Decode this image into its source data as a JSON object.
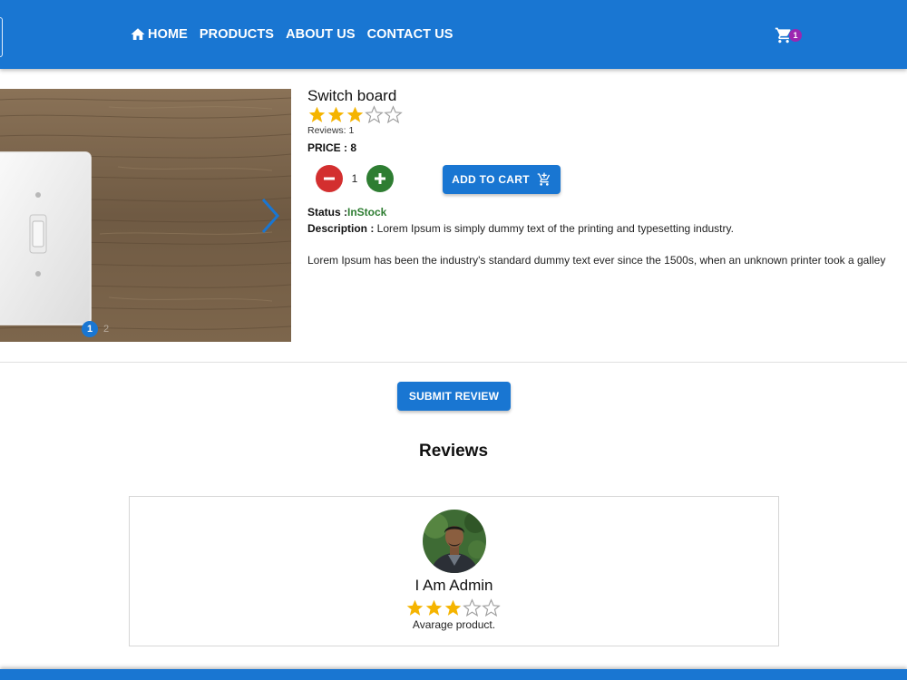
{
  "nav": {
    "items": [
      {
        "label": "HOME",
        "icon": "home-icon"
      },
      {
        "label": "PRODUCTS"
      },
      {
        "label": "ABOUT US"
      },
      {
        "label": "CONTACT US"
      }
    ],
    "cart_count": "1"
  },
  "gallery": {
    "active_dot": "1",
    "dot2": "2"
  },
  "product": {
    "title": "Switch board",
    "rating": 3,
    "rating_max": 5,
    "reviews_label": "Reviews: 1",
    "price_label": "PRICE : 8",
    "quantity": "1",
    "add_to_cart_label": "ADD TO CART",
    "status_label": "Status :",
    "status_value": "InStock",
    "description_label": "Description :",
    "description_text": " Lorem Ipsum is simply dummy text of the printing and typesetting industry.",
    "description_more": "Lorem Ipsum has been the industry's standard dummy text ever since the 1500s, when an unknown printer took a galley"
  },
  "reviews": {
    "submit_label": "SUBMIT REVIEW",
    "heading": "Reviews",
    "items": [
      {
        "name": "I Am Admin",
        "rating": 3,
        "comment": "Avarage product."
      }
    ]
  },
  "colors": {
    "primary": "#1976d2",
    "star": "#f5b400",
    "instock": "#2e7d32",
    "minus": "#d32f2f",
    "plus": "#2e7d32",
    "badge": "#9c27b0"
  }
}
